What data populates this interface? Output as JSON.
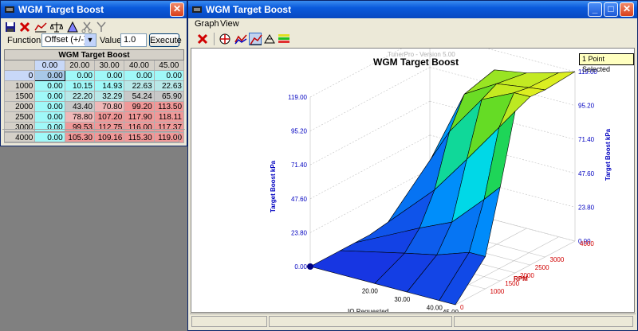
{
  "table_window": {
    "title": "WGM Target Boost",
    "toolbar_icons": [
      "save-icon",
      "delete-icon",
      "graph-icon",
      "balance-icon",
      "interpolate-icon",
      "cut-icon",
      "filter-icon"
    ],
    "function_label": "Function:",
    "function_value": "Offset (+/-)",
    "value_label": "Value:",
    "value_value": "1.0",
    "execute_label": "Execute",
    "grid_title": "WGM Target Boost",
    "columns": [
      "0.00",
      "20.00",
      "30.00",
      "40.00",
      "45.00"
    ],
    "rows": [
      {
        "label": "0",
        "values": [
          "0.00",
          "0.00",
          "0.00",
          "0.00",
          "0.00"
        ]
      },
      {
        "label": "1000",
        "values": [
          "0.00",
          "10.15",
          "14.93",
          "22.63",
          "22.63"
        ]
      },
      {
        "label": "1500",
        "values": [
          "0.00",
          "22.20",
          "32.29",
          "54.24",
          "65.90"
        ]
      },
      {
        "label": "2000",
        "values": [
          "0.00",
          "43.40",
          "70.80",
          "99.20",
          "113.50"
        ]
      },
      {
        "label": "2500",
        "values": [
          "0.00",
          "78.80",
          "107.20",
          "117.90",
          "118.11"
        ]
      },
      {
        "label": "3000",
        "values": [
          "0.00",
          "99.53",
          "112.75",
          "116.00",
          "117.37"
        ]
      },
      {
        "label": "4000",
        "values": [
          "0.00",
          "105.30",
          "109.16",
          "115.30",
          "119.00"
        ]
      }
    ]
  },
  "graph_window": {
    "title": "WGM Target Boost",
    "menu": [
      "Graph",
      "View"
    ],
    "watermark": "TunerPro - Version 5.00",
    "chart_title": "WGM Target Boost",
    "selection_badge": "1 Point Selected",
    "z_label_left": "Target Boost kPa",
    "z_label_right": "Target Boost kPa",
    "x_label": "IO Requested",
    "y_label": "RPM",
    "colors": {
      "low": "#1830e0",
      "mid": "#00d8e8",
      "high": "#e8f020",
      "grid_line": "#c0c0c0",
      "z_tick": "#0000c0",
      "rpm_tick": "#d00000"
    }
  },
  "chart_data": {
    "type": "surface",
    "title": "WGM Target Boost",
    "x": [
      0,
      20,
      30,
      40,
      45
    ],
    "y": [
      0,
      1000,
      1500,
      2000,
      2500,
      3000,
      4000
    ],
    "z": [
      [
        0,
        0,
        0,
        0,
        0
      ],
      [
        0,
        10.15,
        14.93,
        22.63,
        22.63
      ],
      [
        0,
        22.2,
        32.29,
        54.24,
        65.9
      ],
      [
        0,
        43.4,
        70.8,
        99.2,
        113.5
      ],
      [
        0,
        78.8,
        107.2,
        117.9,
        118.11
      ],
      [
        0,
        99.53,
        112.75,
        116.0,
        117.37
      ],
      [
        0,
        105.3,
        109.16,
        115.3,
        119.0
      ]
    ],
    "x_ticks": [
      "0",
      "20.00",
      "30.00",
      "40.00",
      "45.00"
    ],
    "y_ticks": [
      "0",
      "1000",
      "1500",
      "2000",
      "2500",
      "3000",
      "4000"
    ],
    "z_ticks": [
      "0.00",
      "23.80",
      "47.60",
      "71.40",
      "95.20",
      "119.00"
    ],
    "xlabel": "IO Requested",
    "ylabel": "RPM",
    "zlabel": "Target Boost kPa",
    "zlim": [
      0,
      119
    ]
  }
}
